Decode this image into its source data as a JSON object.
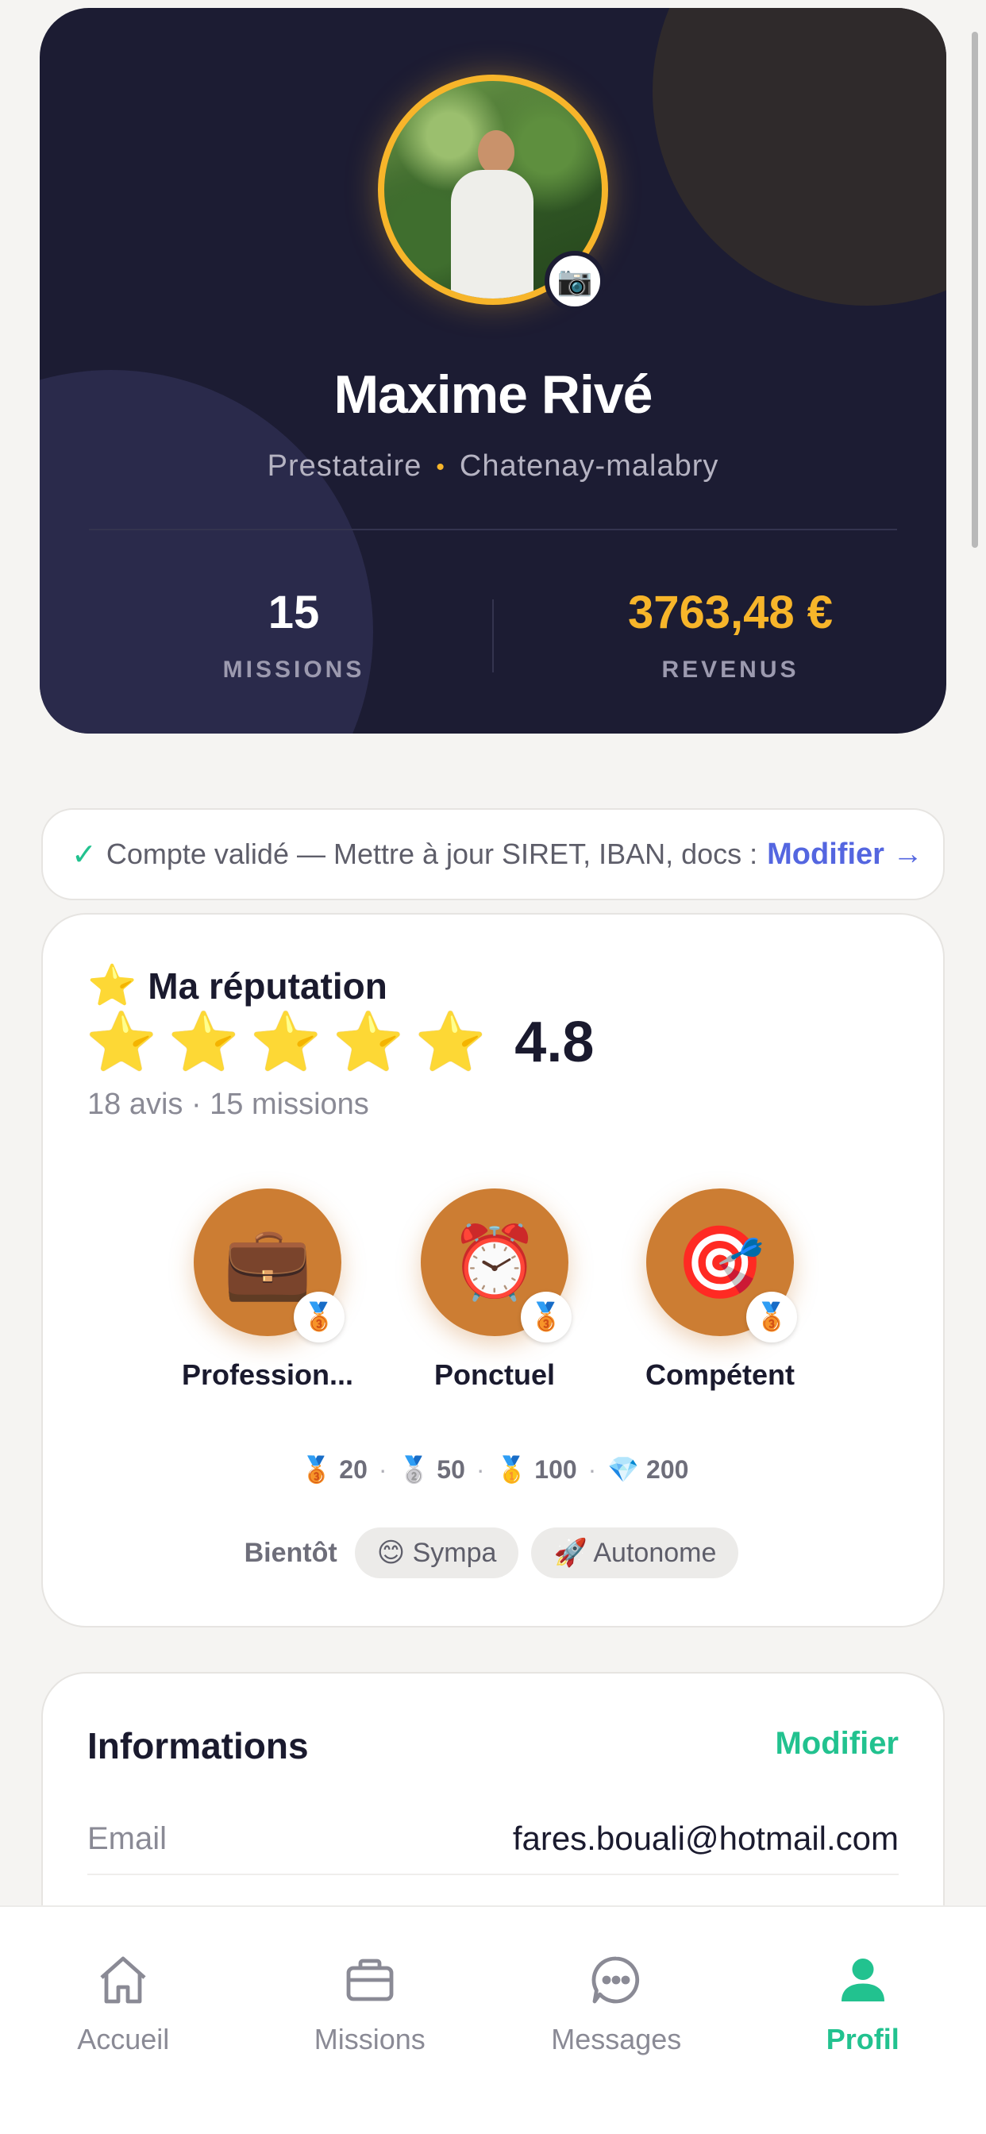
{
  "profile": {
    "name": "Maxime Rivé",
    "role": "Prestataire",
    "separator": "•",
    "city": "Chatenay-malabry",
    "camera_icon": "📷"
  },
  "stats": {
    "missions_value": "15",
    "missions_label": "MISSIONS",
    "revenue_value": "3763,48 €",
    "revenue_label": "REVENUS"
  },
  "banner": {
    "check": "✓",
    "text": "Compte validé — Mettre à jour SIRET, IBAN, docs :",
    "action": "Modifier →"
  },
  "reputation": {
    "title_icon": "⭐",
    "title": "Ma réputation",
    "stars": [
      "⭐",
      "⭐",
      "⭐",
      "⭐",
      "⭐"
    ],
    "rating_value": 4.8,
    "rating": "4.8",
    "summary": "18 avis · 15 missions",
    "badges": [
      {
        "icon": "💼",
        "medal": "🥉",
        "label": "Profession..."
      },
      {
        "icon": "⏰",
        "medal": "🥉",
        "label": "Ponctuel"
      },
      {
        "icon": "🎯",
        "medal": "🥉",
        "label": "Compétent"
      }
    ],
    "tiers": [
      {
        "icon": "🥉",
        "value": "20"
      },
      {
        "icon": "🥈",
        "value": "50"
      },
      {
        "icon": "🥇",
        "value": "100"
      },
      {
        "icon": "💎",
        "value": "200"
      }
    ],
    "tier_sep": "·",
    "soon_label": "Bientôt",
    "soon_items": [
      {
        "icon": "😊",
        "label": "Sympa"
      },
      {
        "icon": "🚀",
        "label": "Autonome"
      }
    ]
  },
  "informations": {
    "title": "Informations",
    "edit": "Modifier",
    "rows": [
      {
        "key": "Email",
        "value": "fares.bouali@hotmail.com"
      }
    ]
  },
  "nav": {
    "items": [
      {
        "label": "Accueil",
        "icon": "home-icon",
        "active": false
      },
      {
        "label": "Missions",
        "icon": "briefcase-icon",
        "active": false
      },
      {
        "label": "Messages",
        "icon": "chat-bubble-icon",
        "active": false
      },
      {
        "label": "Profil",
        "icon": "user-icon",
        "active": true
      }
    ]
  },
  "colors": {
    "hero_bg": "#1c1c33",
    "accent_gold": "#f7b52a",
    "accent_green": "#22c28f",
    "link_blue": "#5466e0",
    "badge_bronze": "#cc7d33"
  }
}
